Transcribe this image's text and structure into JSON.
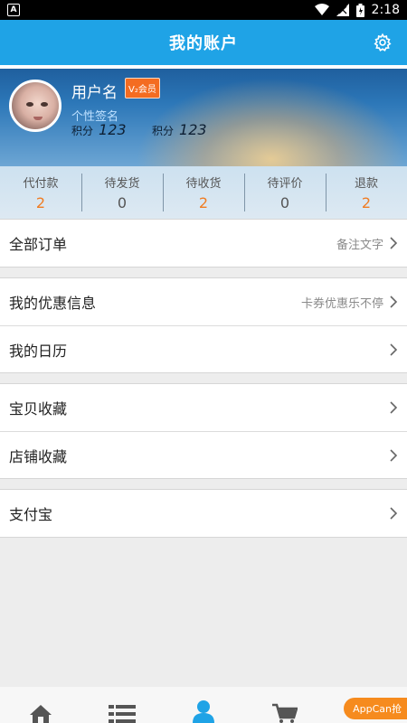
{
  "statusbar": {
    "time": "2:18",
    "notification_letter": "A"
  },
  "header": {
    "title": "我的账户"
  },
  "profile": {
    "username": "用户名",
    "vip_badge": "V₂会员",
    "signature": "个性签名",
    "points": [
      {
        "label": "积分",
        "value": "123"
      },
      {
        "label": "积分",
        "value": "123"
      }
    ]
  },
  "order_stats": [
    {
      "label": "代付款",
      "value": "2"
    },
    {
      "label": "待发货",
      "value": "0"
    },
    {
      "label": "待收货",
      "value": "2"
    },
    {
      "label": "待评价",
      "value": "0"
    },
    {
      "label": "退款",
      "value": "2"
    }
  ],
  "menu": {
    "all_orders": {
      "label": "全部订单",
      "note": "备注文字"
    },
    "coupons": {
      "label": "我的优惠信息",
      "note": "卡券优惠乐不停"
    },
    "calendar": {
      "label": "我的日历"
    },
    "fav_items": {
      "label": "宝贝收藏"
    },
    "fav_shops": {
      "label": "店铺收藏"
    },
    "alipay": {
      "label": "支付宝"
    }
  },
  "tabbar": {
    "tabs": [
      {
        "icon": "home-icon",
        "active": false
      },
      {
        "icon": "list-icon",
        "active": false
      },
      {
        "icon": "user-icon",
        "active": true
      },
      {
        "icon": "cart-icon",
        "active": false
      }
    ],
    "active_color": "#1fa3e6",
    "inactive_color": "#555555"
  },
  "appcan_badge": "AppCan抢"
}
